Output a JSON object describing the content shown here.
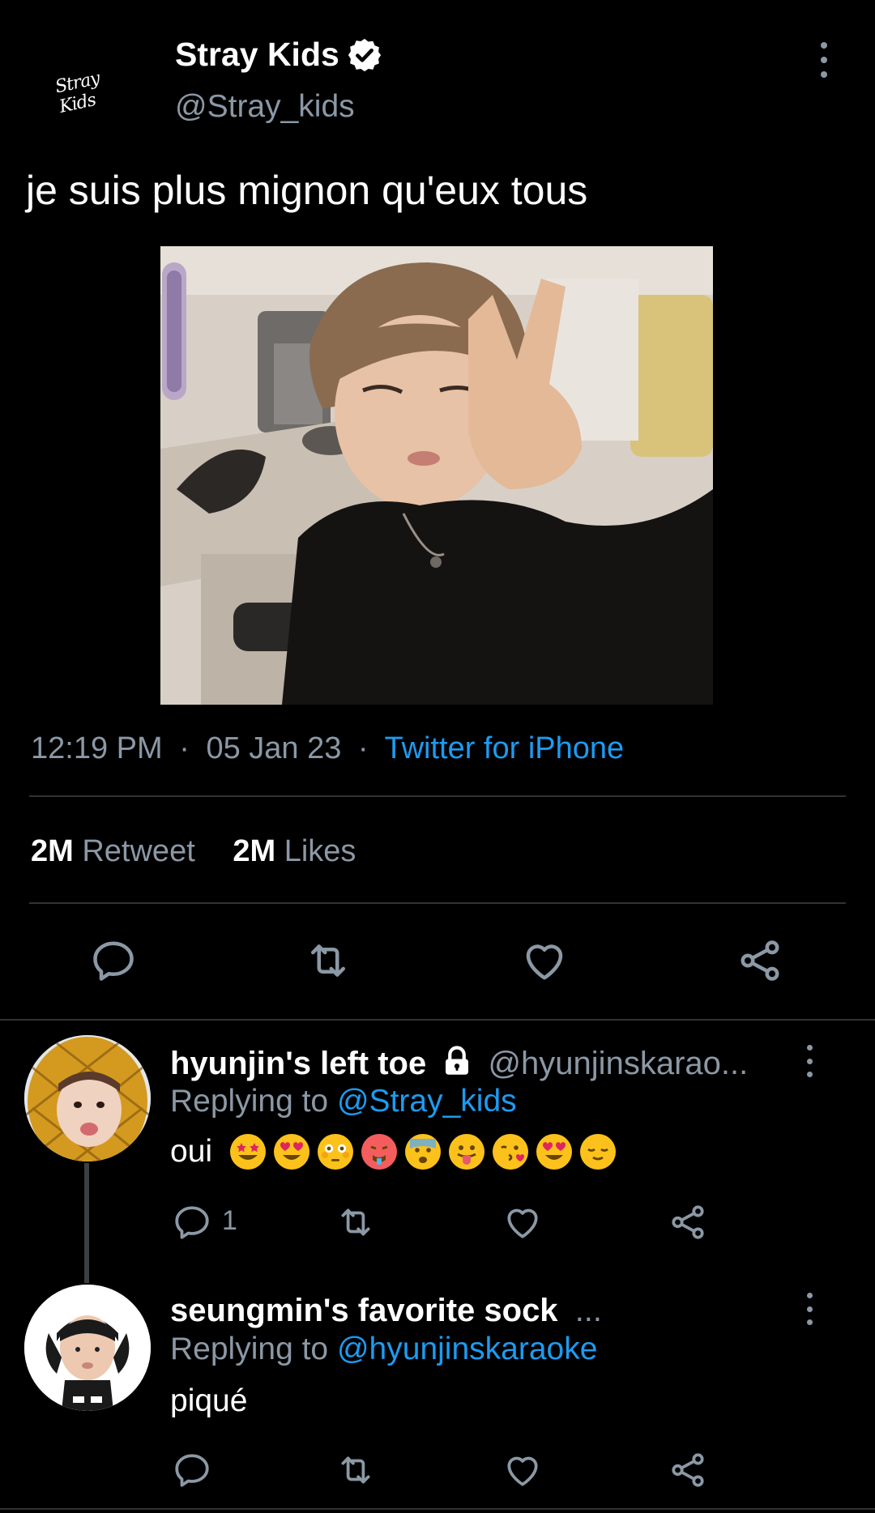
{
  "tweet": {
    "avatar_text": "Stray Kids",
    "display_name": "Stray Kids",
    "handle": "@Stray_kids",
    "text": "je suis plus mignon qu'eux tous",
    "time": "12:19 PM",
    "date": "05 Jan 23",
    "separator": "·",
    "source": "Twitter for iPhone",
    "retweets_count": "2M",
    "retweets_label": "Retweet",
    "likes_count": "2M",
    "likes_label": "Likes"
  },
  "replies": [
    {
      "display_name": "hyunjin's left toe",
      "handle": "@hyunjinskarao...",
      "replying_prefix": "Replying to",
      "replying_to": "@Stray_kids",
      "text": "oui",
      "reply_count": "1"
    },
    {
      "display_name": "seungmin's favorite sock",
      "handle": "...",
      "replying_prefix": "Replying to",
      "replying_to": "@hyunjinskaraoke",
      "text": "piqué",
      "reply_count": ""
    }
  ],
  "icons": {
    "verified": "verified-badge-icon",
    "more": "more-vertical-icon",
    "reply": "reply-icon",
    "retweet": "retweet-icon",
    "like": "heart-icon",
    "share": "share-icon",
    "lock": "lock-icon"
  },
  "colors": {
    "background": "#000000",
    "secondary_text": "#8b98a5",
    "link": "#1d9bf0",
    "divider": "#2f3336"
  }
}
